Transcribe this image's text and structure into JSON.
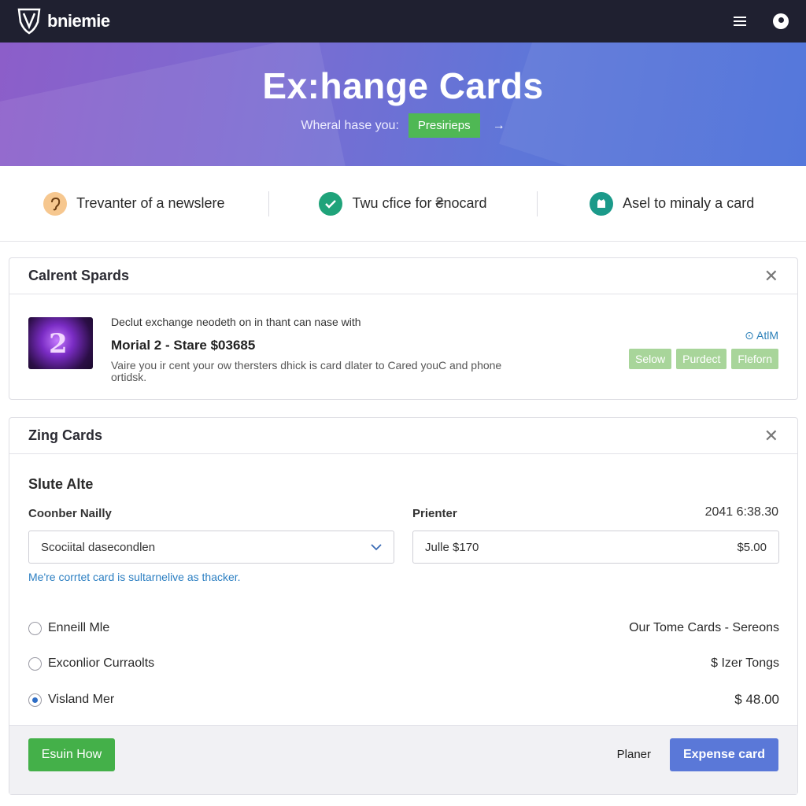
{
  "app": {
    "logo_text": "bniemie"
  },
  "navbar": {
    "menu_icon": "hamburger-icon",
    "user_icon": "user-icon"
  },
  "hero": {
    "title": "Ex:hange  Cards",
    "subtitle": "Wheral hase you:",
    "cta_label": "Presirieps",
    "arrow": "→",
    "gradient_start": "#8c5ec9",
    "gradient_end": "#4a6fd9"
  },
  "features": [
    {
      "icon": "ear-icon",
      "label": "Trevanter of a newslere"
    },
    {
      "icon": "check-icon",
      "label": "Twu cfice for ₴nocard"
    },
    {
      "icon": "badge-icon",
      "label": "Asel to minaly a card"
    }
  ],
  "current_cards": {
    "title": "Calrent Spards",
    "description": "Declut exchange neodeth on in thant can nase with",
    "name": "Morial 2 -",
    "name_detail": "Stare  $03685",
    "note": "Vaire you ir cent your ow thersters dhick is card dlater to Cared youC and phone ortidsk.",
    "atm_label": "⊙ AtlM",
    "tags": [
      "Selow",
      "Purdect",
      "Fleforn"
    ]
  },
  "zing_cards": {
    "title": "Zing Cards",
    "subheading": "Slute Alte",
    "coonber_label": "Coonber Nailly",
    "printer_label": "Prienter",
    "timestamp": "2041 6:38.30",
    "select_value": "Scociital dasecondlen",
    "price_field_label": "Julle $170",
    "price_field_amount": "$5.00",
    "hint": "Me're corrtet card is sultarnelive as thacker.",
    "options": [
      {
        "label": "Enneill Mle",
        "right": "Our Tome Cards - Sereons",
        "selected": false
      },
      {
        "label": "Exconlior Curraolts",
        "right": "$ Izer Tongs",
        "selected": false
      },
      {
        "label": "Visland Mer",
        "right": "$ 48.00",
        "selected": true
      }
    ],
    "buttons": {
      "left": "Esuin How",
      "plain": "Planer",
      "primary": "Expense card"
    }
  }
}
